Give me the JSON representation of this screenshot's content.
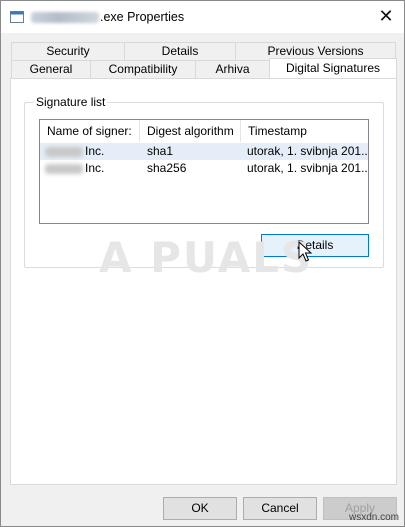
{
  "window": {
    "title": ".exe Properties",
    "close_glyph": "✕"
  },
  "tabs": {
    "row1": [
      {
        "label": "Security"
      },
      {
        "label": "Details"
      },
      {
        "label": "Previous Versions"
      }
    ],
    "row2": [
      {
        "label": "General"
      },
      {
        "label": "Compatibility"
      },
      {
        "label": "Arhiva"
      },
      {
        "label": "Digital Signatures",
        "active": true
      }
    ]
  },
  "signature_list": {
    "label": "Signature list",
    "columns": [
      "Name of signer:",
      "Digest algorithm",
      "Timestamp"
    ],
    "rows": [
      {
        "signer": "Inc.",
        "digest": "sha1",
        "timestamp": "utorak, 1. svibnja 201..."
      },
      {
        "signer": "Inc.",
        "digest": "sha256",
        "timestamp": "utorak, 1. svibnja 201..."
      }
    ],
    "details_button": "Details"
  },
  "buttons": {
    "ok": "OK",
    "cancel": "Cancel",
    "apply": "Apply"
  },
  "watermark": "A  PUALS",
  "credit": "wsxdn.com",
  "icons": {
    "app": "executable-file-icon",
    "close": "close-icon",
    "cursor": "mouse-pointer-icon"
  }
}
